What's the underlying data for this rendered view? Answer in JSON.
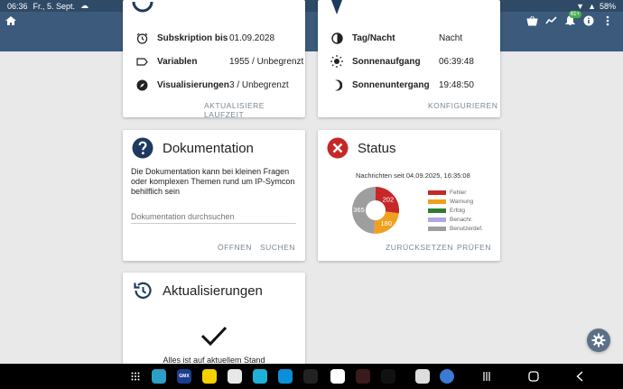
{
  "statusbar": {
    "time": "06:36",
    "date": "Fr., 5. Sept.",
    "battery": "58%"
  },
  "appbar": {
    "badge": "61+"
  },
  "license": {
    "rows": [
      {
        "label": "Subskription bis",
        "value": "01.09.2028",
        "icon": "alarm-clock-icon"
      },
      {
        "label": "Variablen",
        "value": "1955 / Unbegrenzt",
        "icon": "label-tag-icon"
      },
      {
        "label": "Visualisierungen",
        "value": "3 / Unbegrenzt",
        "icon": "compass-icon"
      }
    ],
    "action": "AKTUALISIERE LAUFZEIT"
  },
  "location": {
    "rows": [
      {
        "label": "Tag/Nacht",
        "value": "Nacht",
        "icon": "half-circle-icon"
      },
      {
        "label": "Sonnenaufgang",
        "value": "06:39:48",
        "icon": "sun-icon"
      },
      {
        "label": "Sonnenuntergang",
        "value": "19:48:50",
        "icon": "moon-icon"
      }
    ],
    "action": "KONFIGURIEREN"
  },
  "docs": {
    "title": "Dokumentation",
    "description": "Die Dokumentation kann bei kleinen Fragen oder komplexen Themen rund um IP-Symcon behilflich sein",
    "placeholder": "Dokumentation durchsuchen",
    "open": "ÖFFNEN",
    "search": "SUCHEN"
  },
  "status": {
    "title": "Status",
    "subtitle": "Nachrichten seit 04.09.2025, 16:35:08",
    "reset": "ZURÜCKSETZEN",
    "check": "PRÜFEN",
    "colors": {
      "error": "#c62828",
      "warning": "#f0a020",
      "success": "#2e7d32",
      "notify": "#b0a8e0",
      "custom": "#9e9e9e"
    }
  },
  "chart_data": {
    "type": "pie",
    "categories": [
      "Fehler",
      "Warnung",
      "Erfolg",
      "Benachr.",
      "Benutzerdef."
    ],
    "values": [
      202,
      180,
      0,
      0,
      365
    ],
    "labels": [
      "202",
      "180",
      "",
      "",
      "365"
    ]
  },
  "updates": {
    "title": "Aktualisierungen",
    "message": "Alles ist auf aktuellem Stand"
  },
  "taskbar": {
    "app_label": "GMX"
  }
}
